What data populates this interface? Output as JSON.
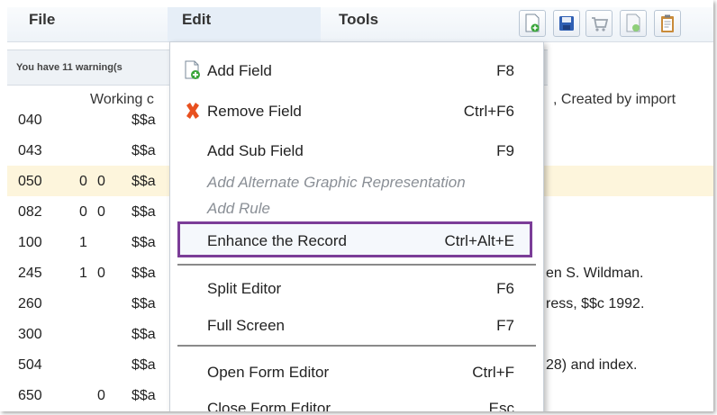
{
  "menubar": {
    "file": "File",
    "edit": "Edit",
    "tools": "Tools",
    "toolbar_icons": [
      "add-record-icon",
      "save-icon",
      "shopping-cart-icon",
      "new-document-icon",
      "clipboard-icon"
    ]
  },
  "warnings": {
    "text": "You have 11 warning(s"
  },
  "record": {
    "info_left": "Working c",
    "info_right": ", Created by import"
  },
  "rows": [
    {
      "tag": "040",
      "ind1": "",
      "ind2": "",
      "sub": "$$a",
      "rest": ""
    },
    {
      "tag": "043",
      "ind1": "",
      "ind2": "",
      "sub": "$$a",
      "rest": ""
    },
    {
      "tag": "050",
      "ind1": "0",
      "ind2": "0",
      "sub": "$$a",
      "rest": ""
    },
    {
      "tag": "082",
      "ind1": "0",
      "ind2": "0",
      "sub": "$$a",
      "rest": ""
    },
    {
      "tag": "100",
      "ind1": "1",
      "ind2": "",
      "sub": "$$a",
      "rest": ""
    },
    {
      "tag": "245",
      "ind1": "1",
      "ind2": "0",
      "sub": "$$a",
      "rest": "en S. Wildman."
    },
    {
      "tag": "260",
      "ind1": "",
      "ind2": "",
      "sub": "$$a",
      "rest": "ress, $$c 1992."
    },
    {
      "tag": "300",
      "ind1": "",
      "ind2": "",
      "sub": "$$a",
      "rest": ""
    },
    {
      "tag": "504",
      "ind1": "",
      "ind2": "",
      "sub": "$$a",
      "rest": "28) and index."
    },
    {
      "tag": "650",
      "ind1": "",
      "ind2": "0",
      "sub": "$$a",
      "rest": ""
    }
  ],
  "highlighted_row": "050",
  "edit_menu": {
    "items": [
      {
        "label": "Add Field",
        "shortcut": "F8",
        "icon": "add-field-icon"
      },
      {
        "label": "Remove Field",
        "shortcut": "Ctrl+F6",
        "icon": "remove-field-icon"
      },
      {
        "label": "Add Sub Field",
        "shortcut": "F9"
      },
      {
        "label": "Add Alternate Graphic Representation",
        "shortcut": "",
        "disabled": true
      },
      {
        "label": "Add Rule",
        "shortcut": "",
        "disabled": true
      },
      {
        "label": "Enhance the Record",
        "shortcut": "Ctrl+Alt+E",
        "selected": true
      },
      {
        "label": "Split Editor",
        "shortcut": "F6"
      },
      {
        "label": "Full Screen",
        "shortcut": "F7"
      },
      {
        "label": "Open Form Editor",
        "shortcut": "Ctrl+F"
      },
      {
        "label": "Close Form Editor",
        "shortcut": "Esc"
      }
    ]
  },
  "colors": {
    "highlight_row": "#fdf5dc",
    "selected_border": "#7b3d98",
    "remove_icon": "#e8501f",
    "add_icon": "#3aa53a"
  }
}
